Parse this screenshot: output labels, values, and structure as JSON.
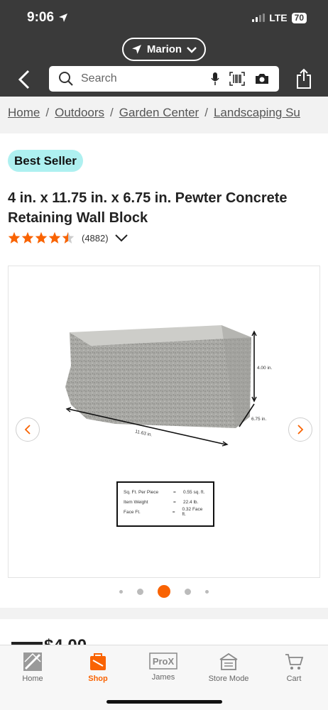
{
  "status": {
    "time": "9:06",
    "network": "LTE",
    "battery": "70"
  },
  "location": {
    "label": "Marion"
  },
  "search": {
    "placeholder": "Search"
  },
  "breadcrumb": [
    "Home",
    "Outdoors",
    "Garden Center",
    "Landscaping Su"
  ],
  "product": {
    "badge": "Best Seller",
    "title": "4 in. x 11.75 in. x 6.75 in. Pewter Concrete Retaining Wall Block",
    "rating": 4.5,
    "review_count": "(4882)",
    "price_partial": "$4.00"
  },
  "image": {
    "height_label": "4.00 in.",
    "depth_label": "6.75 in.",
    "width_label": "11.63 in.",
    "specs": [
      {
        "key": "Sq. Ft. Per Piece",
        "eq": "=",
        "value": "0.55 sq. ft."
      },
      {
        "key": "Item Weight",
        "eq": "=",
        "value": "22.4 lb."
      },
      {
        "key": "Face Ft.",
        "eq": "=",
        "value": "0.32 Face ft."
      }
    ]
  },
  "carousel": {
    "total_dots": 5,
    "active_dot": 3
  },
  "tabs": [
    {
      "label": "Home",
      "icon": "home-depot-logo-icon",
      "active": false
    },
    {
      "label": "Shop",
      "icon": "shop-bag-icon",
      "active": true
    },
    {
      "label": "James",
      "icon": "prox-icon",
      "active": false
    },
    {
      "label": "Store Mode",
      "icon": "store-icon",
      "active": false
    },
    {
      "label": "Cart",
      "icon": "cart-icon",
      "active": false
    }
  ],
  "colors": {
    "brand_orange": "#f96302",
    "header_bg": "#3a3a3a",
    "badge_bg": "#aef0f0"
  }
}
